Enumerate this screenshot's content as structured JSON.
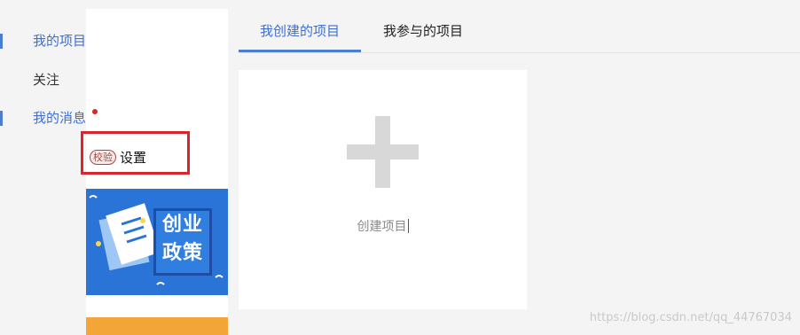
{
  "sidebar": {
    "items": [
      {
        "label": "我的项目"
      },
      {
        "label": "关注"
      },
      {
        "label": "我的消息"
      },
      {
        "label": "设置",
        "badge": "校验"
      }
    ]
  },
  "banner": {
    "line1": "创业",
    "line2": "政策"
  },
  "tabs": [
    {
      "label": "我创建的项目"
    },
    {
      "label": "我参与的项目"
    }
  ],
  "create_card": {
    "label": "创建项目"
  },
  "watermark": "https://blog.csdn.net/qq_44767034",
  "colors": {
    "accent": "#4a7fd0",
    "highlight": "#d8262f",
    "banner": "#2a74d8"
  }
}
